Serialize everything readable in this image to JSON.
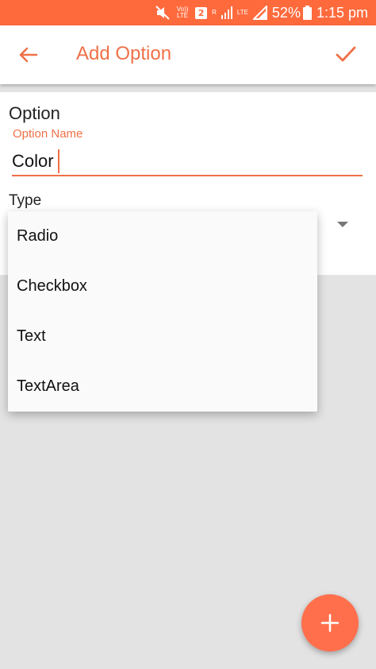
{
  "status_bar": {
    "volte": "Vo)) LTE",
    "sim_slot": "2",
    "roaming": "R",
    "network": "LTE",
    "battery": "52%",
    "time": "1:15 pm"
  },
  "app_bar": {
    "title": "Add Option",
    "back_icon": "arrow-left-icon",
    "confirm_icon": "check-icon"
  },
  "form": {
    "section_title": "Option",
    "option_name": {
      "label": "Option Name",
      "value": "Color"
    },
    "type_label": "Type"
  },
  "dropdown": {
    "options": [
      "Radio",
      "Checkbox",
      "Text",
      "TextArea"
    ]
  },
  "fab": {
    "icon": "plus-icon"
  },
  "colors": {
    "accent": "#f07048",
    "status_bar": "#ff6a3d",
    "fab": "#ff6f4c"
  }
}
